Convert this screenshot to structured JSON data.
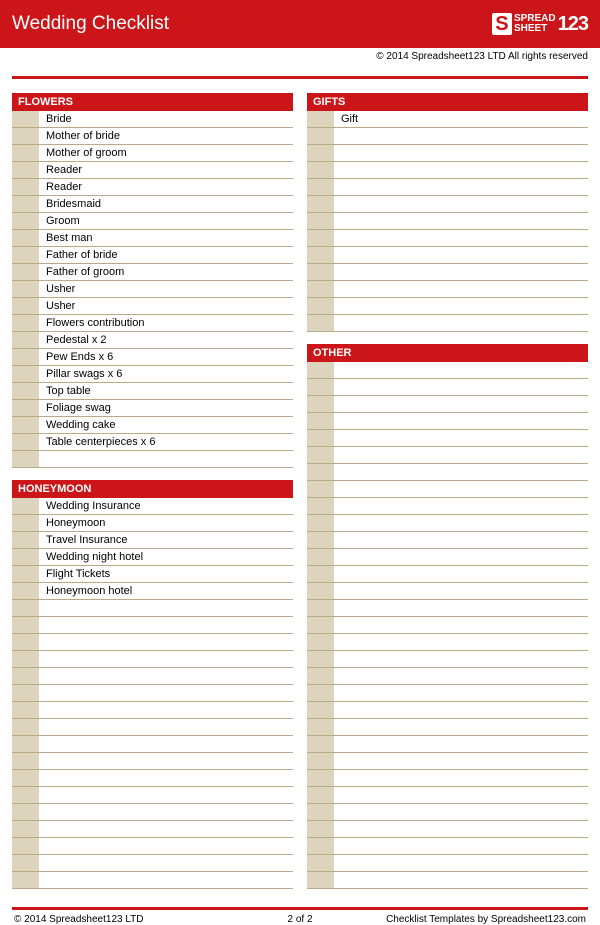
{
  "header": {
    "title": "Wedding Checklist",
    "logo_text_top": "SPREAD",
    "logo_text_bottom": "SHEET",
    "logo_123": "123"
  },
  "copyright_top": "© 2014 Spreadsheet123 LTD All rights reserved",
  "left_sections": [
    {
      "title": "FLOWERS",
      "rows": 21,
      "items": [
        "Bride",
        "Mother of bride",
        "Mother of groom",
        "Reader",
        "Reader",
        "Bridesmaid",
        "Groom",
        "Best man",
        "Father of bride",
        "Father of groom",
        "Usher",
        "Usher",
        "Flowers contribution",
        "Pedestal x 2",
        "Pew Ends x 6",
        "Pillar swags x 6",
        "Top table",
        "Foliage swag",
        "Wedding cake",
        "Table centerpieces x 6"
      ]
    },
    {
      "title": "HONEYMOON",
      "rows": 23,
      "items": [
        "Wedding Insurance",
        "Honeymoon",
        "Travel Insurance",
        "Wedding night hotel",
        "Flight Tickets",
        "Honeymoon hotel"
      ]
    }
  ],
  "right_sections": [
    {
      "title": "GIFTS",
      "rows": 13,
      "items": [
        "Gift"
      ]
    },
    {
      "title": "OTHER",
      "rows": 31,
      "items": []
    }
  ],
  "footer": {
    "left": "© 2014 Spreadsheet123 LTD",
    "mid": "2 of 2",
    "right": "Checklist Templates by Spreadsheet123.com"
  }
}
